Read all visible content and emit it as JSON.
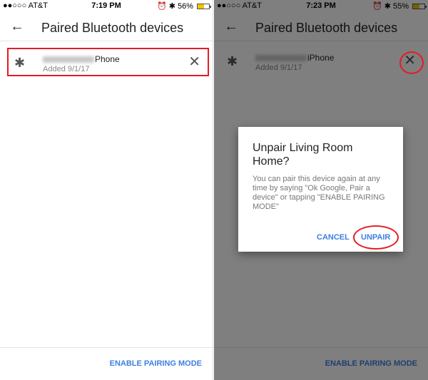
{
  "left": {
    "status": {
      "carrier": "●●○○○ AT&T",
      "wifi": "≋",
      "time": "7:19 PM",
      "alarm": "⏰",
      "bt": "✱",
      "battery_pct": "56%",
      "battery_level": 0.56
    },
    "title": "Paired Bluetooth devices",
    "device": {
      "name_suffix": "Phone",
      "added": "Added 9/1/17"
    },
    "footer_button": "ENABLE PAIRING MODE"
  },
  "right": {
    "status": {
      "carrier": "●●○○○ AT&T",
      "wifi": "≋",
      "time": "7:23 PM",
      "alarm": "⏰",
      "bt": "✱",
      "battery_pct": "55%",
      "battery_level": 0.55
    },
    "title": "Paired Bluetooth devices",
    "device": {
      "name_suffix": "iPhone",
      "added": "Added 9/1/17"
    },
    "footer_button": "ENABLE PAIRING MODE",
    "dialog": {
      "title": "Unpair Living Room Home?",
      "body": "You can pair this device again at any time by saying \"Ok Google, Pair a device\" or tapping \"ENABLE PAIRING MODE\"",
      "cancel": "CANCEL",
      "unpair": "UNPAIR"
    }
  },
  "icons": {
    "back": "←",
    "bluetooth": "✱",
    "close": "✕"
  },
  "colors": {
    "accent": "#3d7fe0",
    "highlight": "#e51c23",
    "battery": "#f2c300"
  }
}
